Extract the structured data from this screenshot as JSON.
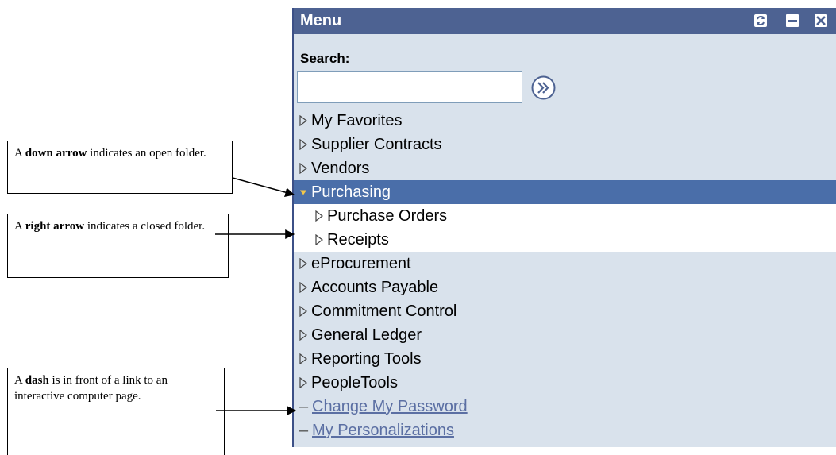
{
  "callouts": {
    "down": {
      "prefix": "A ",
      "bold": "down arrow",
      "suffix": " indicates an open folder."
    },
    "right": {
      "prefix": "A ",
      "bold": "right arrow",
      "suffix": "  indicates a closed folder."
    },
    "dash": {
      "prefix": "A ",
      "bold": "dash",
      "suffix": " is in front of a link to an interactive computer page."
    }
  },
  "menu": {
    "title": "Menu",
    "header_icons": [
      "refresh-icon",
      "minimize-icon",
      "close-icon"
    ],
    "search_label": "Search:",
    "search_value": "",
    "search_go_icon": "double-chevron-right-icon",
    "items_top": [
      {
        "label": "My Favorites",
        "state": "closed"
      },
      {
        "label": "Supplier Contracts",
        "state": "closed"
      },
      {
        "label": "Vendors",
        "state": "closed"
      }
    ],
    "open_folder": {
      "label": "Purchasing",
      "state": "open"
    },
    "children": [
      {
        "label": "Purchase Orders",
        "state": "closed"
      },
      {
        "label": "Receipts",
        "state": "closed"
      }
    ],
    "items_bottom": [
      {
        "label": "eProcurement",
        "state": "closed"
      },
      {
        "label": "Accounts Payable",
        "state": "closed"
      },
      {
        "label": "Commitment Control",
        "state": "closed"
      },
      {
        "label": "General Ledger",
        "state": "closed"
      },
      {
        "label": "Reporting Tools",
        "state": "closed"
      },
      {
        "label": "PeopleTools",
        "state": "closed"
      }
    ],
    "links": [
      {
        "label": "Change My Password"
      },
      {
        "label": "My Personalizations"
      }
    ]
  },
  "colors": {
    "header_bg": "#4d6292",
    "panel_bg": "#d9e2ec",
    "open_row_bg": "#4a6ea9",
    "link": "#5b6fa3"
  }
}
